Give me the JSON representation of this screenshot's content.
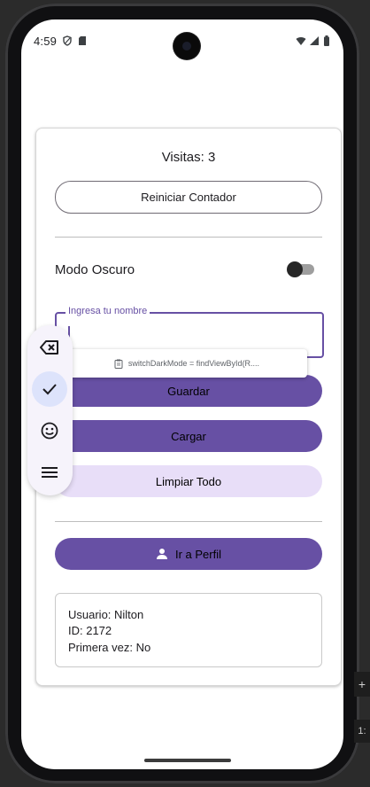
{
  "status_bar": {
    "time": "4:59",
    "icons": [
      "shield-icon",
      "sd-card-icon",
      "wifi-icon",
      "signal-icon",
      "battery-icon"
    ]
  },
  "app": {
    "visits_text": "Visitas: 3",
    "reset_button": "Reiniciar Contador",
    "dark_mode_label": "Modo Oscuro",
    "dark_mode_enabled": false,
    "name_field": {
      "label": "Ingresa tu nombre",
      "value": ""
    },
    "save_button": "Guardar",
    "load_button": "Cargar",
    "clear_button": "Limpiar Todo",
    "profile_button": "Ir a Perfil",
    "info": {
      "user_line": "Usuario: Nilton",
      "id_line": "ID: 2172",
      "first_time_line": "Primera vez: No"
    }
  },
  "floating_toolbar": {
    "items": [
      "backspace-icon",
      "check-icon",
      "emoji-icon",
      "menu-icon"
    ],
    "selected": "check-icon"
  },
  "clipboard_suggestion": {
    "text": "switchDarkMode = findViewById(R...."
  },
  "side_controls": {
    "zoom_label": "1:",
    "plus_label": "+"
  },
  "colors": {
    "primary": "#6750a4",
    "tonal": "#e8def8",
    "selected_tool": "#dde3fb"
  }
}
